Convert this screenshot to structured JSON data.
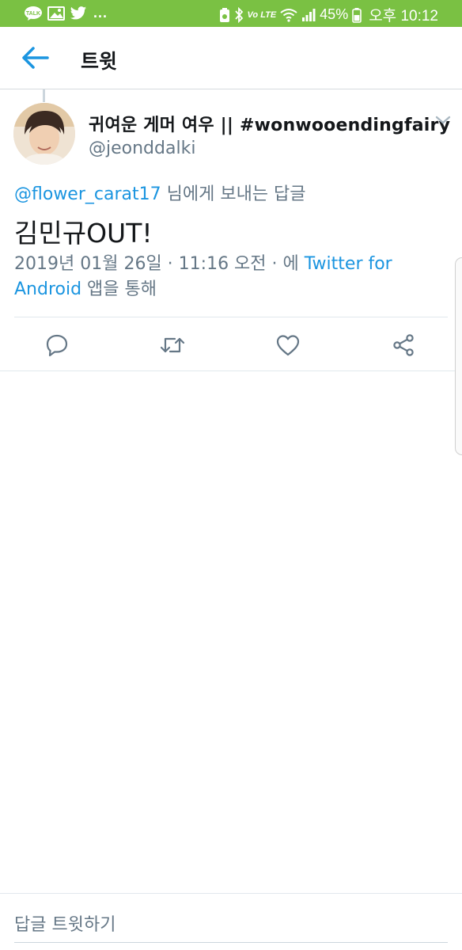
{
  "status_bar": {
    "left_icons": [
      "kakaotalk-icon",
      "gallery-icon",
      "twitter-icon"
    ],
    "overflow": "...",
    "right_icons": [
      "alarm-icon",
      "bluetooth-icon",
      "volte-icon",
      "wifi-icon",
      "signal-icon",
      "battery-icon"
    ],
    "network_label": "Vo LTE",
    "battery": "45%",
    "time": "오후 10:12",
    "background_color": "#7ac143"
  },
  "header": {
    "title": "트윗",
    "accent_color": "#1b95e0"
  },
  "tweet": {
    "display_name": "귀여운 게머 여우 || #wonwooendingfairy",
    "handle": "@jeonddalki",
    "reply_to_mention": "@flower_carat17",
    "reply_to_suffix": " 님에게 보내는 답글",
    "text": "김민규OUT!",
    "timestamp": "2019년 01월 26일 · 11:16 오전 · 에 ",
    "source_app": "Twitter for Android",
    "source_suffix": " 앱을 통해"
  },
  "actions": [
    "reply-icon",
    "retweet-icon",
    "like-icon",
    "share-icon"
  ],
  "compose": {
    "placeholder": "답글 트윗하기"
  }
}
